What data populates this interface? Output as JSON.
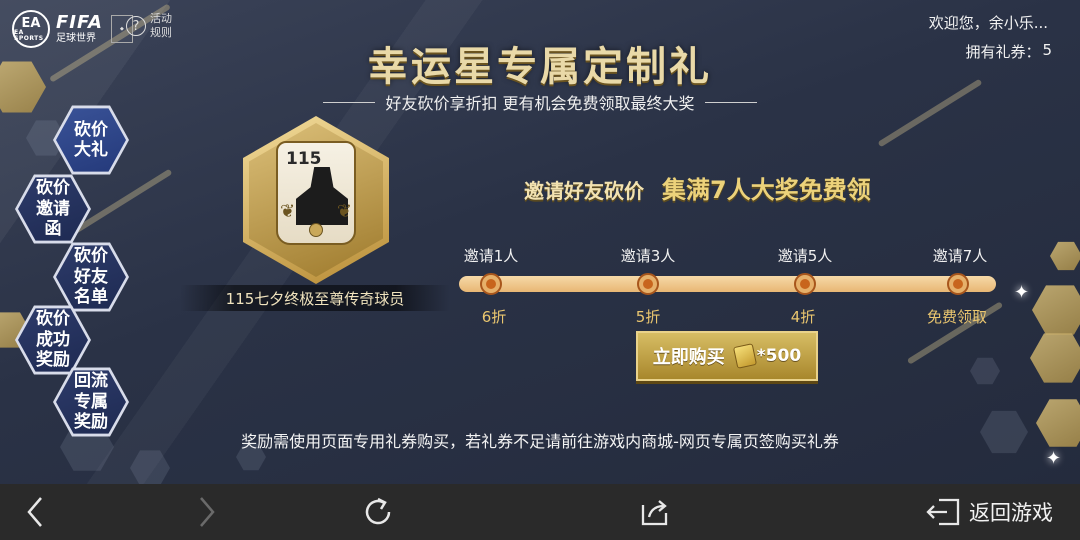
{
  "header": {
    "brand_badge": "EA SPORTS",
    "brand_name": "FIFA",
    "brand_subtitle": "足球世界",
    "rules_label": "活动规则",
    "welcome_text": "欢迎您，余小乐...",
    "coupon_label": "拥有礼券：",
    "coupon_count": "5"
  },
  "banner": {
    "title": "幸运星专属定制礼",
    "subtitle": "好友砍价享折扣 更有机会免费领取最终大奖"
  },
  "menu": {
    "items": [
      {
        "label": "砍价大礼",
        "active": true
      },
      {
        "label": "砍价邀请函",
        "active": false
      },
      {
        "label": "砍价好友名单",
        "active": false
      },
      {
        "label": "砍价成功奖励",
        "active": false
      },
      {
        "label": "回流专属奖励",
        "active": false
      }
    ]
  },
  "prize_card": {
    "rating": "115",
    "caption": "115七夕终极至尊传奇球员"
  },
  "invite": {
    "headline": "邀请好友砍价",
    "highlight": "集满7人大奖免费领"
  },
  "progress": {
    "steps": [
      {
        "label": "邀请1人",
        "reward": "6折"
      },
      {
        "label": "邀请3人",
        "reward": "5折"
      },
      {
        "label": "邀请5人",
        "reward": "4折"
      },
      {
        "label": "邀请7人",
        "reward": "免费领取"
      }
    ]
  },
  "buy": {
    "label": "立即购买",
    "cost": "*500"
  },
  "notice": "奖励需使用页面专用礼券购买，若礼券不足请前往游戏内商城-网页专属页签购买礼券",
  "navbar": {
    "back_game_label": "返回游戏"
  },
  "colors": {
    "accent_gold": "#d7bd64",
    "reward_gold": "#eac66f",
    "menu_blue": "#2d3b6a"
  }
}
